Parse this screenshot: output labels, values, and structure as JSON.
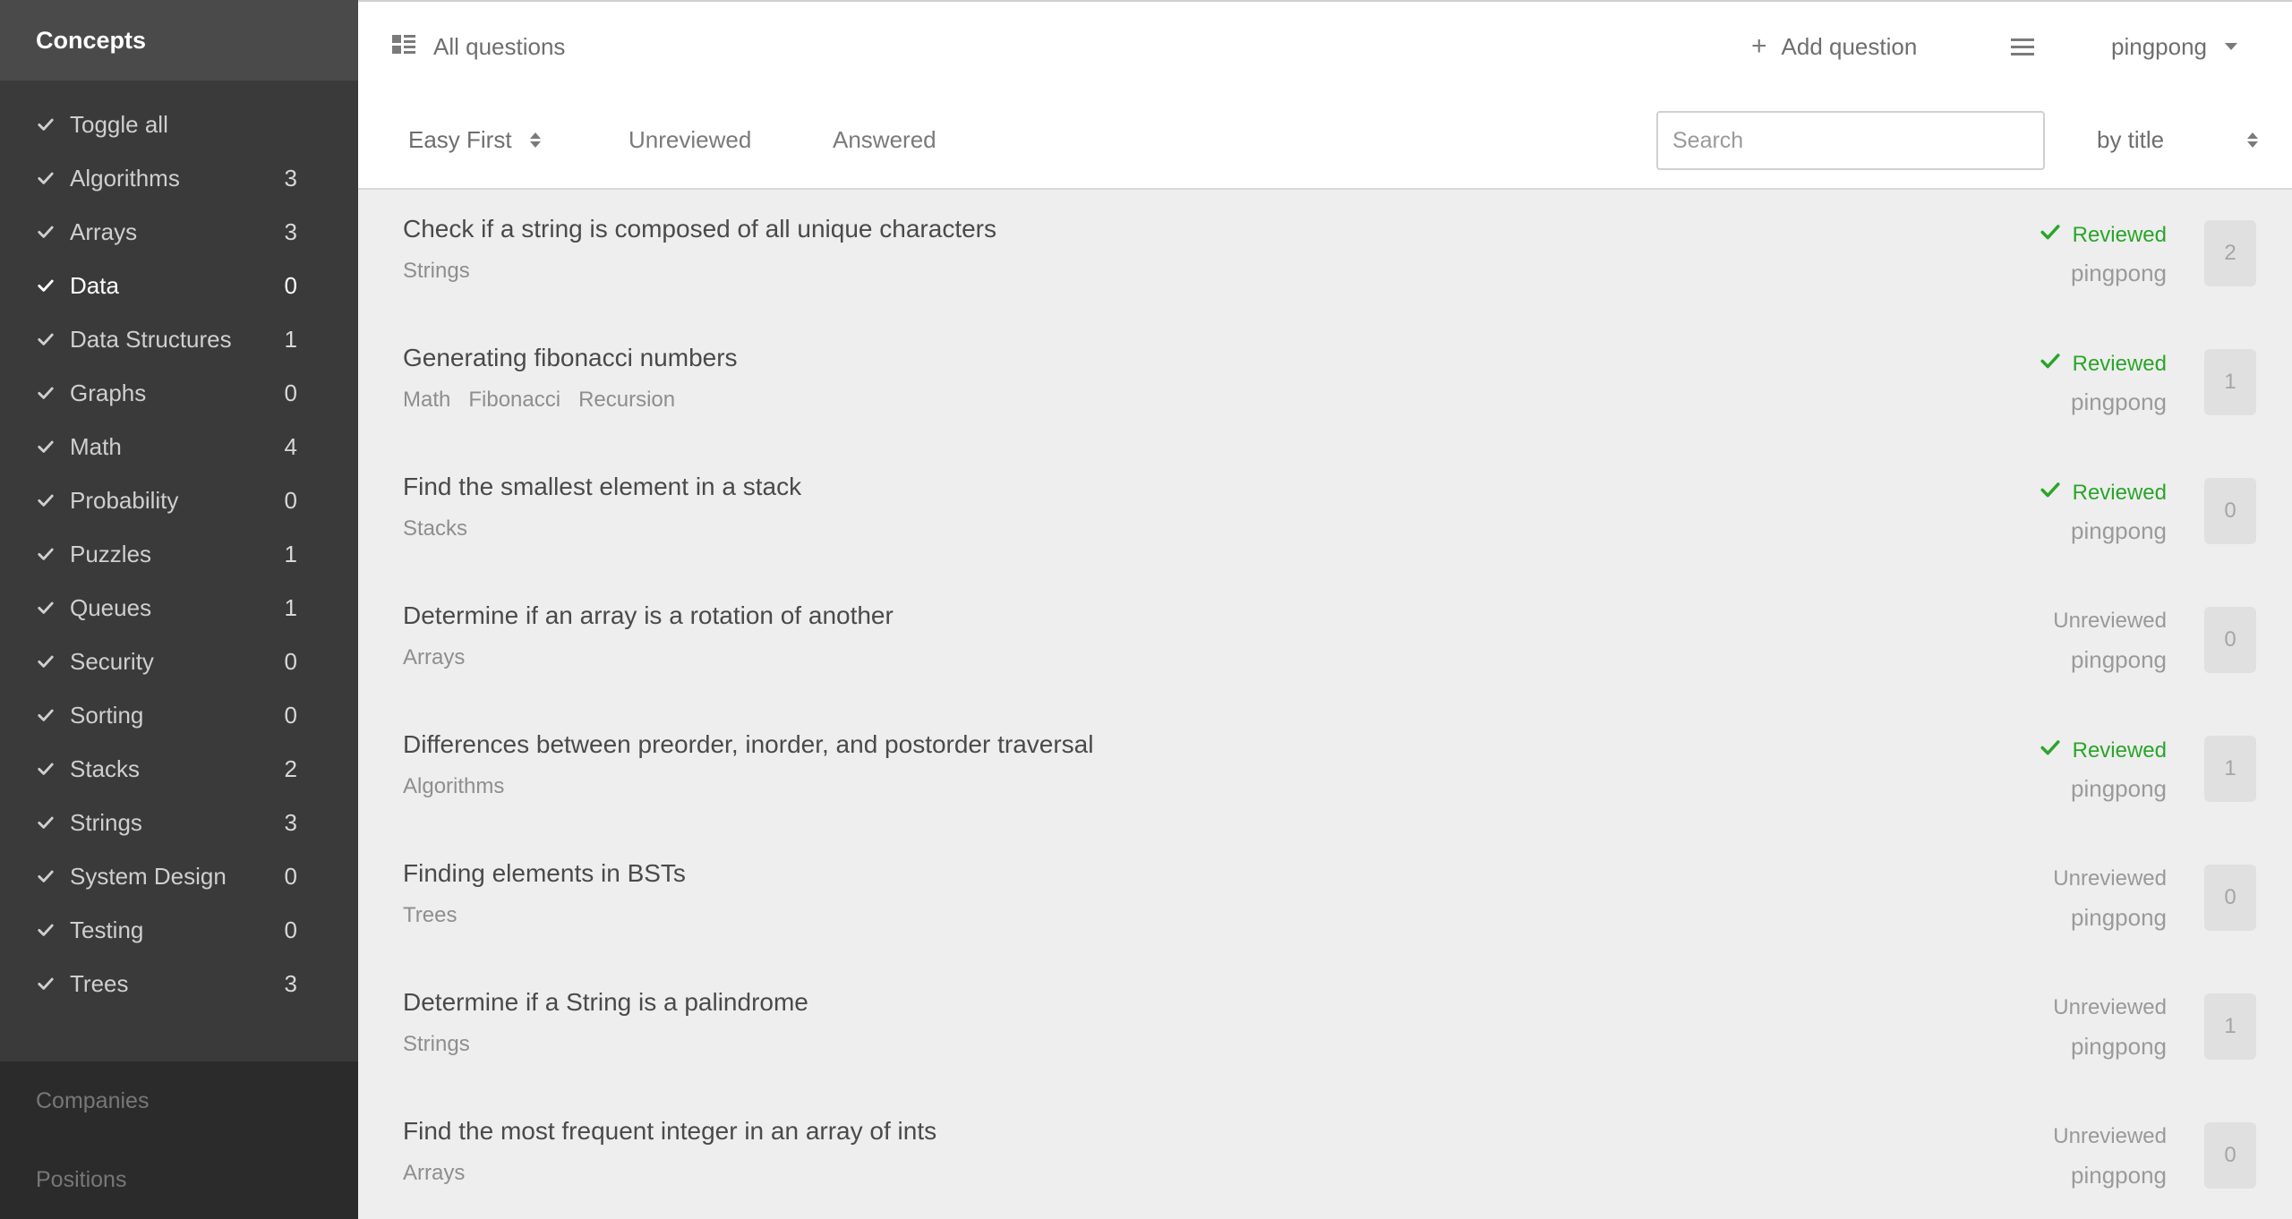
{
  "sidebar": {
    "header": "Concepts",
    "concepts": [
      {
        "label": "Toggle all",
        "count": ""
      },
      {
        "label": "Algorithms",
        "count": "3"
      },
      {
        "label": "Arrays",
        "count": "3"
      },
      {
        "label": "Data",
        "count": "0"
      },
      {
        "label": "Data Structures",
        "count": "1"
      },
      {
        "label": "Graphs",
        "count": "0"
      },
      {
        "label": "Math",
        "count": "4"
      },
      {
        "label": "Probability",
        "count": "0"
      },
      {
        "label": "Puzzles",
        "count": "1"
      },
      {
        "label": "Queues",
        "count": "1"
      },
      {
        "label": "Security",
        "count": "0"
      },
      {
        "label": "Sorting",
        "count": "0"
      },
      {
        "label": "Stacks",
        "count": "2"
      },
      {
        "label": "Strings",
        "count": "3"
      },
      {
        "label": "System Design",
        "count": "0"
      },
      {
        "label": "Testing",
        "count": "0"
      },
      {
        "label": "Trees",
        "count": "3"
      }
    ],
    "active_concept": "Data",
    "companies_label": "Companies",
    "positions_label": "Positions"
  },
  "topbar": {
    "all_questions_label": "All questions",
    "add_question_label": "Add question",
    "username": "pingpong"
  },
  "filters": {
    "sort_value": "Easy First",
    "unreviewed_label": "Unreviewed",
    "answered_label": "Answered",
    "search_placeholder": "Search",
    "search_value": "",
    "search_by_value": "by title"
  },
  "questions": [
    {
      "title": "Check if a string is composed of all unique characters",
      "tags": [
        "Strings"
      ],
      "status": "Reviewed",
      "reviewed": true,
      "author": "pingpong",
      "count": "2"
    },
    {
      "title": "Generating fibonacci numbers",
      "tags": [
        "Math",
        "Fibonacci",
        "Recursion"
      ],
      "status": "Reviewed",
      "reviewed": true,
      "author": "pingpong",
      "count": "1"
    },
    {
      "title": "Find the smallest element in a stack",
      "tags": [
        "Stacks"
      ],
      "status": "Reviewed",
      "reviewed": true,
      "author": "pingpong",
      "count": "0"
    },
    {
      "title": "Determine if an array is a rotation of another",
      "tags": [
        "Arrays"
      ],
      "status": "Unreviewed",
      "reviewed": false,
      "author": "pingpong",
      "count": "0"
    },
    {
      "title": "Differences between preorder, inorder, and postorder traversal",
      "tags": [
        "Algorithms"
      ],
      "status": "Reviewed",
      "reviewed": true,
      "author": "pingpong",
      "count": "1"
    },
    {
      "title": "Finding elements in BSTs",
      "tags": [
        "Trees"
      ],
      "status": "Unreviewed",
      "reviewed": false,
      "author": "pingpong",
      "count": "0"
    },
    {
      "title": "Determine if a String is a palindrome",
      "tags": [
        "Strings"
      ],
      "status": "Unreviewed",
      "reviewed": false,
      "author": "pingpong",
      "count": "1"
    },
    {
      "title": "Find the most frequent integer in an array of ints",
      "tags": [
        "Arrays"
      ],
      "status": "Unreviewed",
      "reviewed": false,
      "author": "pingpong",
      "count": "0"
    }
  ],
  "colors": {
    "sidebar_bg": "#3a3a3a",
    "sidebar_header_bg": "#4a4a4a",
    "reviewed_green": "#2aa52a",
    "content_bg": "#eeeeee"
  },
  "icons": {
    "concept_check": "check-icon",
    "all_questions": "list-view-icon",
    "add_question": "plus-icon",
    "menu": "hamburger-menu-icon",
    "user_dropdown": "caret-down-icon",
    "sort": "sort-updown-icon",
    "reviewed": "check-icon"
  }
}
